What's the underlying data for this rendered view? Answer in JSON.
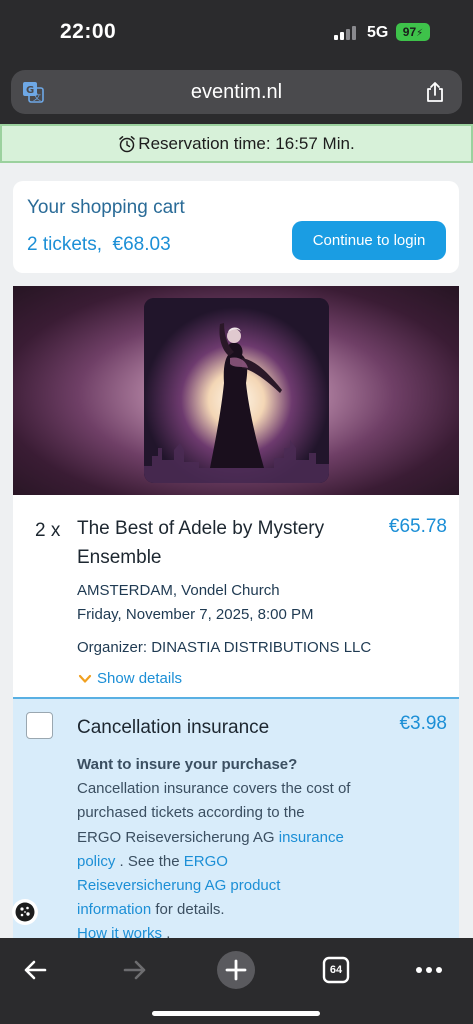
{
  "status_bar": {
    "time": "22:00",
    "network": "5G",
    "battery": "97"
  },
  "browser": {
    "url": "eventim.nl",
    "tab_count": "64"
  },
  "reservation": {
    "text": "Reservation time: 16:57 Min."
  },
  "cart": {
    "title": "Your shopping cart",
    "summary": "2 tickets,  €68.03",
    "login_button": "Continue to login"
  },
  "event": {
    "quantity": "2 x",
    "title": "The Best of Adele by Mystery Ensemble",
    "price": "€65.78",
    "venue": "AMSTERDAM, Vondel Church",
    "datetime": "Friday, November 7, 2025, 8:00 PM",
    "organizer": "Organizer: DINASTIA DISTRIBUTIONS LLC",
    "show_details": "Show details"
  },
  "insurance": {
    "title": "Cancellation insurance",
    "price": "€3.98",
    "question": "Want to insure your purchase?",
    "body_1": "Cancellation insurance covers the cost of purchased tickets according to the ERGO Reiseversicherung AG",
    "link_policy": "insurance policy",
    "body_2": ". See the",
    "link_product_info": "ERGO Reiseversicherung AG product information",
    "body_3": "for details.",
    "link_how": "How it works",
    "body_4": "."
  },
  "colors": {
    "accent": "#1a9de3",
    "reservation_bg": "#d7f1d9",
    "insurance_bg": "#d8ecfa"
  }
}
